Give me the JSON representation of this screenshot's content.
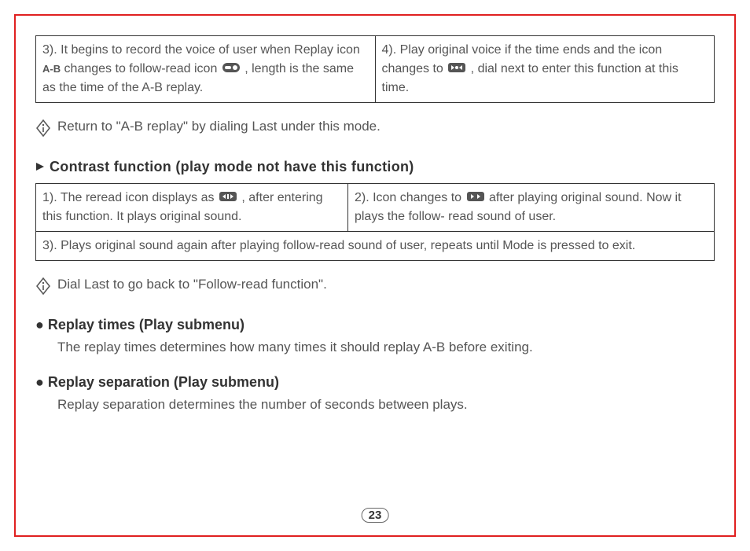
{
  "table1": {
    "cell1_pre": "3). It begins to record the voice of user when Replay icon ",
    "cell1_ab": "A-B",
    "cell1_mid": " changes to follow-read icon ",
    "cell1_post": " , length is the same as the time of the A-B replay.",
    "cell2_pre": " 4). Play original voice if the time ends and the icon changes to ",
    "cell2_post": " , dial next to enter this function at this time."
  },
  "tip1": "Return to \"A-B replay\" by dialing Last under this mode.",
  "heading1": "Contrast function (play mode not have this function)",
  "table2": {
    "r1c1_pre": "1). The reread icon displays as ",
    "r1c1_post": " , after entering this function. It plays original sound.",
    "r1c2_pre": "2). Icon changes to ",
    "r1c2_post": " after playing original sound. Now it plays the follow- read sound of user.",
    "r2": "3). Plays original sound again after playing follow-read sound of user, repeats until Mode is pressed to exit."
  },
  "tip2": "Dial Last to go back to \"Follow-read function\".",
  "bullet1_heading": "Replay times (Play submenu)",
  "bullet1_body": "The replay times determines how many times it should replay A-B before exiting.",
  "bullet2_heading": "Replay separation (Play submenu)",
  "bullet2_body": "Replay separation determines the number of seconds between plays.",
  "page_number": "23"
}
